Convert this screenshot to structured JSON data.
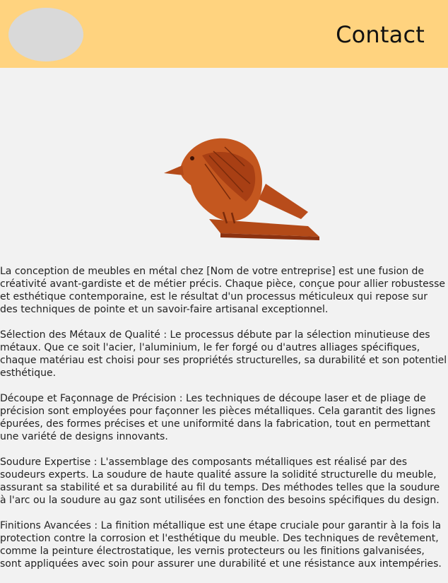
{
  "header": {
    "logo_name": "logo",
    "contact_label": "Contact"
  },
  "hero": {
    "image": "metal-bird-sculpture"
  },
  "content": {
    "paragraphs": [
      "La conception de meubles en métal chez [Nom de votre entreprise] est une fusion de créativité avant-gardiste et de métier précis. Chaque pièce, conçue pour allier robustesse et esthétique contemporaine, est le résultat d'un processus méticuleux qui repose sur des techniques de pointe et un savoir-faire artisanal exceptionnel.",
      "Sélection des Métaux de Qualité : Le processus débute par la sélection minutieuse des métaux. Que ce soit l'acier, l'aluminium, le fer forgé ou d'autres alliages spécifiques, chaque matériau est choisi pour ses propriétés structurelles, sa durabilité et son potentiel esthétique.",
      "Découpe et Façonnage de Précision : Les techniques de découpe laser et de pliage de précision sont employées pour façonner les pièces métalliques. Cela garantit des lignes épurées, des formes précises et une uniformité dans la fabrication, tout en permettant une variété de designs innovants.",
      "Soudure Expertise : L'assemblage des composants métalliques est réalisé par des soudeurs experts. La soudure de haute qualité assure la solidité structurelle du meuble, assurant sa stabilité et sa durabilité au fil du temps. Des méthodes telles que la soudure à l'arc ou la soudure au gaz sont utilisées en fonction des besoins spécifiques du design.",
      "Finitions Avancées : La finition métallique est une étape cruciale pour garantir à la fois la protection contre la corrosion et l'esthétique du meuble. Des techniques de revêtement, comme la peinture électrostatique, les vernis protecteurs ou les finitions galvanisées, sont appliquées avec soin pour assurer une durabilité et une résistance aux intempéries."
    ]
  }
}
